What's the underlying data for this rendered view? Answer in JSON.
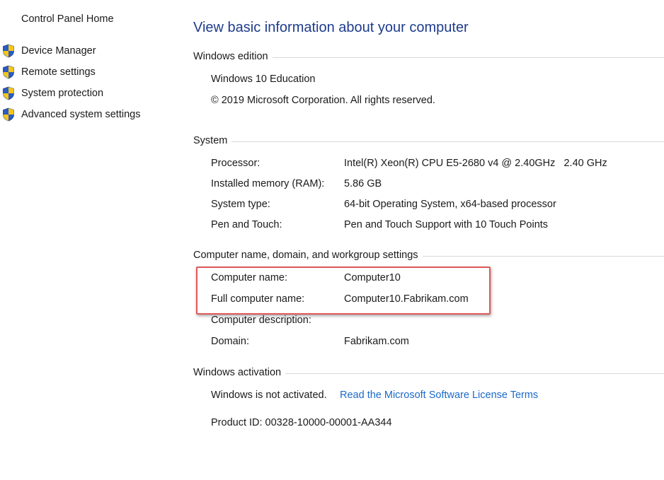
{
  "sidebar": {
    "home_label": "Control Panel Home",
    "items": [
      {
        "label": "Device Manager",
        "icon": "uac-shield-icon"
      },
      {
        "label": "Remote settings",
        "icon": "uac-shield-icon"
      },
      {
        "label": "System protection",
        "icon": "uac-shield-icon"
      },
      {
        "label": "Advanced system settings",
        "icon": "uac-shield-icon"
      }
    ]
  },
  "main": {
    "title": "View basic information about your computer",
    "windows_edition": {
      "heading": "Windows edition",
      "edition": "Windows 10 Education",
      "copyright": "© 2019 Microsoft Corporation. All rights reserved."
    },
    "system": {
      "heading": "System",
      "rows": [
        {
          "label": "Processor:",
          "value": "Intel(R) Xeon(R) CPU E5-2680 v4 @ 2.40GHz   2.40 GHz"
        },
        {
          "label": "Installed memory (RAM):",
          "value": "5.86 GB"
        },
        {
          "label": "System type:",
          "value": "64-bit Operating System, x64-based processor"
        },
        {
          "label": "Pen and Touch:",
          "value": "Pen and Touch Support with 10 Touch Points"
        }
      ]
    },
    "computer_name": {
      "heading": "Computer name, domain, and workgroup settings",
      "rows": [
        {
          "label": "Computer name:",
          "value": "Computer10"
        },
        {
          "label": "Full computer name:",
          "value": "Computer10.Fabrikam.com"
        },
        {
          "label": "Computer description:",
          "value": ""
        },
        {
          "label": "Domain:",
          "value": "Fabrikam.com"
        }
      ]
    },
    "activation": {
      "heading": "Windows activation",
      "status": "Windows is not activated.",
      "license_link": "Read the Microsoft Software License Terms",
      "product_id": "Product ID: 00328-10000-00001-AA344"
    }
  },
  "colors": {
    "title": "#1e3c8c",
    "link": "#1b6ac9",
    "highlight_border": "#e0585a",
    "shield_blue": "#2a5cc4",
    "shield_yellow": "#f5c518"
  }
}
